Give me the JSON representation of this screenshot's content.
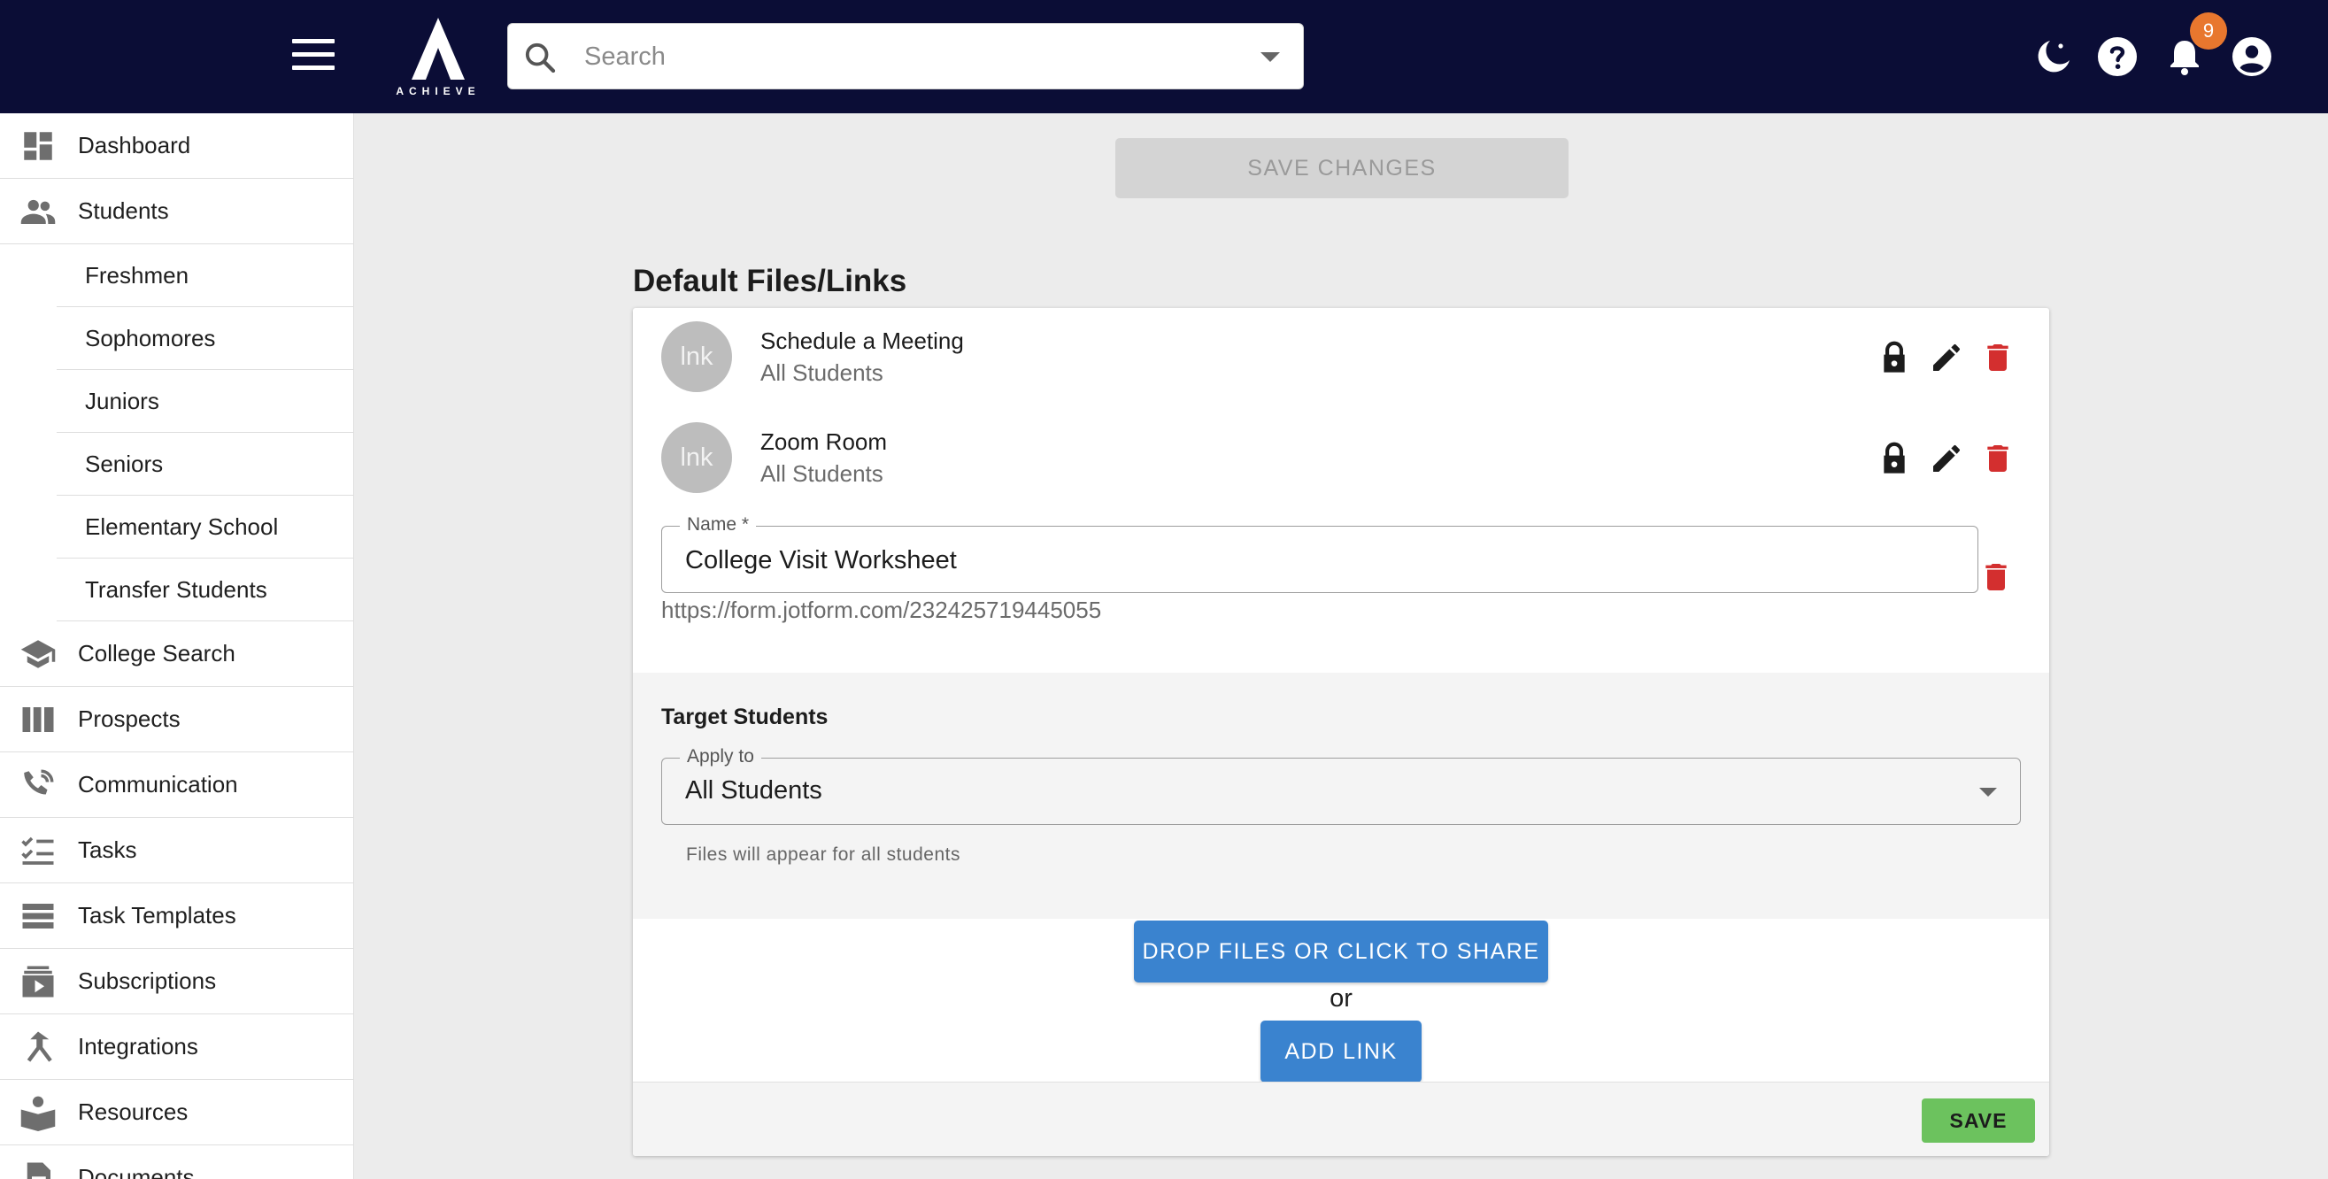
{
  "header": {
    "logo_text": "ACHIEVE",
    "search_placeholder": "Search",
    "notification_count": "9"
  },
  "sidebar": {
    "items": [
      {
        "label": "Dashboard",
        "icon": "dashboard-icon"
      },
      {
        "label": "Students",
        "icon": "people-icon"
      },
      {
        "label": "College Search",
        "icon": "school-icon"
      },
      {
        "label": "Prospects",
        "icon": "columns-icon"
      },
      {
        "label": "Communication",
        "icon": "communication-icon"
      },
      {
        "label": "Tasks",
        "icon": "checklist-icon"
      },
      {
        "label": "Task Templates",
        "icon": "list-icon"
      },
      {
        "label": "Subscriptions",
        "icon": "subscriptions-icon"
      },
      {
        "label": "Integrations",
        "icon": "merge-icon"
      },
      {
        "label": "Resources",
        "icon": "reader-icon"
      },
      {
        "label": "Documents",
        "icon": "document-icon"
      }
    ],
    "student_subitems": [
      "Freshmen",
      "Sophomores",
      "Juniors",
      "Seniors",
      "Elementary School",
      "Transfer Students"
    ]
  },
  "main": {
    "save_changes_label": "SAVE CHANGES",
    "section_title": "Default Files/Links",
    "files": [
      {
        "avatar": "lnk",
        "name": "Schedule a Meeting",
        "audience": "All Students"
      },
      {
        "avatar": "lnk",
        "name": "Zoom Room",
        "audience": "All Students"
      }
    ],
    "edit_form": {
      "name_label": "Name *",
      "name_value": "College Visit Worksheet",
      "url": "https://form.jotform.com/232425719445055"
    },
    "target": {
      "title": "Target Students",
      "apply_label": "Apply to",
      "apply_value": "All Students",
      "helper": "Files will appear for all students"
    },
    "drop_label": "DROP FILES OR CLICK TO SHARE",
    "or_text": "or",
    "add_link_label": "ADD LINK",
    "save_label": "SAVE"
  },
  "colors": {
    "topbar": "#0b0d36",
    "primary_button": "#3a83cf",
    "save_button": "#6cc25e",
    "delete": "#d32f2f",
    "badge": "#e8772e"
  }
}
